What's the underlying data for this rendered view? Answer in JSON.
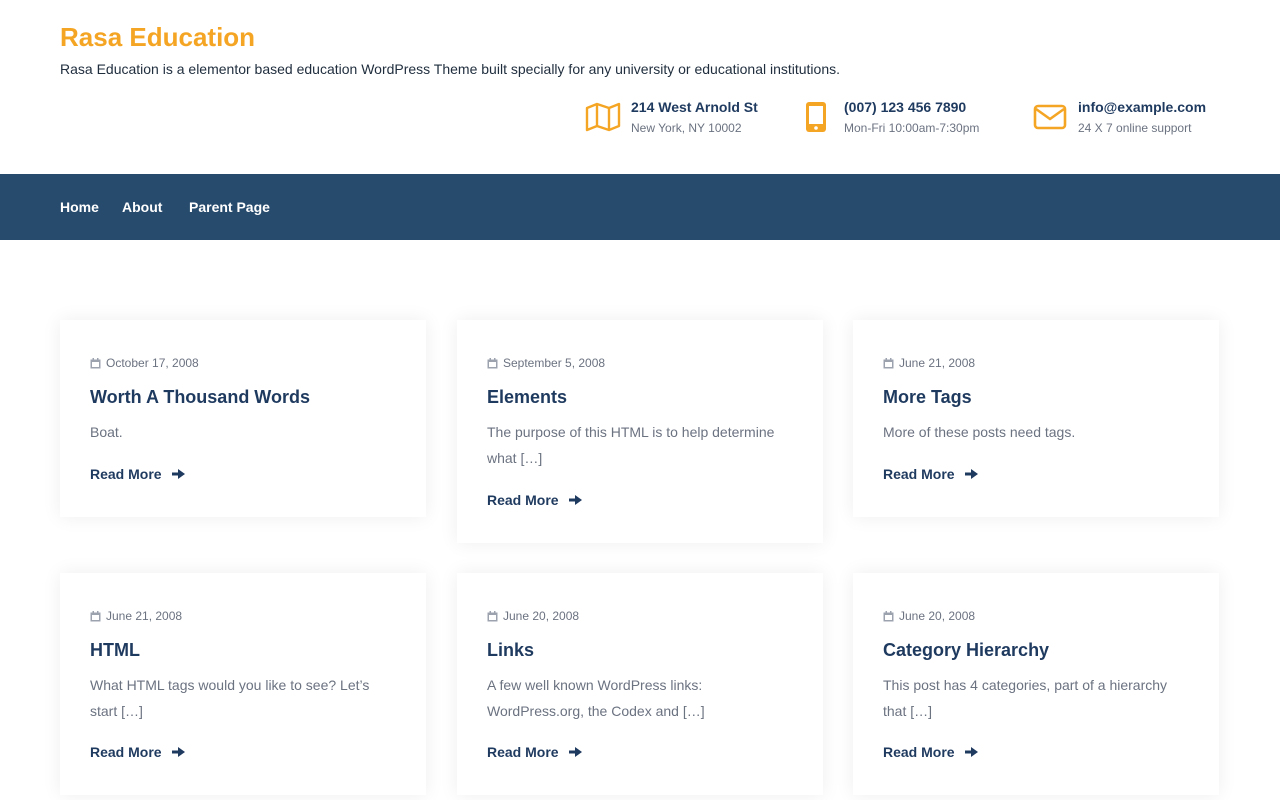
{
  "site": {
    "title": "Rasa Education",
    "description": "Rasa Education is a elementor based education WordPress Theme built specially for any university or educational institutions."
  },
  "contacts": [
    {
      "icon": "map-icon",
      "line1": "214 West Arnold St",
      "line2": "New York, NY 10002"
    },
    {
      "icon": "mobile-phone-icon",
      "line1": "(007) 123 456 7890",
      "line2": "Mon-Fri 10:00am-7:30pm"
    },
    {
      "icon": "envelope-icon",
      "line1": "info@example.com",
      "line2": "24 X 7 online support"
    }
  ],
  "nav": {
    "items": [
      "Home",
      "About",
      "Parent Page"
    ]
  },
  "colors": {
    "accent": "#f5a524",
    "nav_bg": "#274b6d",
    "heading": "#1f3a5f"
  },
  "posts": [
    {
      "date": "October 17, 2008",
      "title": "Worth A Thousand Words",
      "excerpt": "Boat.",
      "read_more": "Read More"
    },
    {
      "date": "September 5, 2008",
      "title": "Elements",
      "excerpt": "The purpose of this HTML is to help determine what […]",
      "read_more": "Read More"
    },
    {
      "date": "June 21, 2008",
      "title": "More Tags",
      "excerpt": "More of these posts need tags.",
      "read_more": "Read More"
    },
    {
      "date": "June 21, 2008",
      "title": "HTML",
      "excerpt": "What HTML tags would you like to see? Let’s start […]",
      "read_more": "Read More"
    },
    {
      "date": "June 20, 2008",
      "title": "Links",
      "excerpt": "A few well known WordPress links: WordPress.org, the Codex and […]",
      "read_more": "Read More"
    },
    {
      "date": "June 20, 2008",
      "title": "Category Hierarchy",
      "excerpt": "This post has 4 categories, part of a hierarchy that […]",
      "read_more": "Read More"
    }
  ]
}
